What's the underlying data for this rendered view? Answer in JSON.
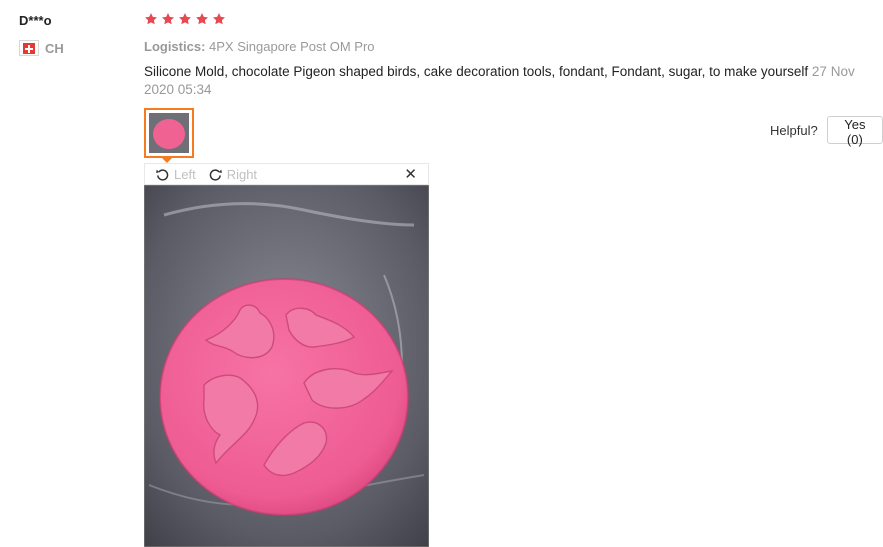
{
  "reviewer": {
    "name": "D***o",
    "country_code": "CH"
  },
  "rating": {
    "stars": 5,
    "color": "#e8484f"
  },
  "logistics": {
    "label": "Logistics:",
    "value": "4PX Singapore Post OM Pro"
  },
  "review": {
    "text": "Silicone Mold, chocolate Pigeon shaped birds, cake decoration tools, fondant, Fondant, sugar, to make yourself",
    "date": "27 Nov 2020 05:34"
  },
  "helpful": {
    "label": "Helpful?",
    "yes_label": "Yes (0)"
  },
  "viewer": {
    "left_label": "Left",
    "right_label": "Right"
  },
  "colors": {
    "accent": "#f47b20",
    "mold_pink": "#f06292",
    "muted": "#999999"
  }
}
